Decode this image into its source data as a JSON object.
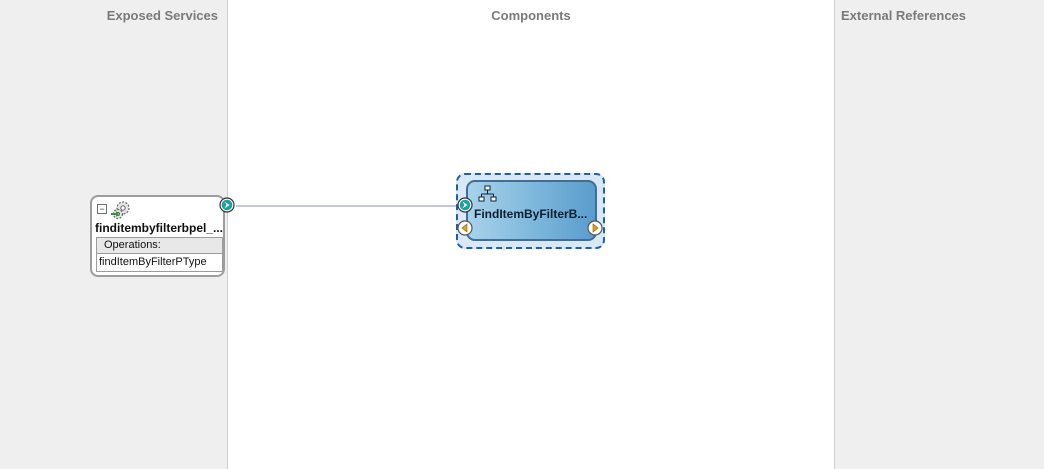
{
  "lanes": {
    "exposed_services": "Exposed Services",
    "components": "Components",
    "external_references": "External References"
  },
  "service": {
    "name": "finditembyfilterbpel_...",
    "collapse_symbol": "−",
    "operations_header": "Operations:",
    "operations": [
      "findItemByFilterPType"
    ],
    "icon": "gear-service-icon"
  },
  "component": {
    "name": "FindItemByFilterB...",
    "icon": "bpel-process-icon"
  },
  "colors": {
    "lane_bg": "#efefef",
    "wire": "#c4c4e6",
    "component_border": "#1f5ea8",
    "port_service": "#18a3a0",
    "port_reference": "#e8a317"
  }
}
